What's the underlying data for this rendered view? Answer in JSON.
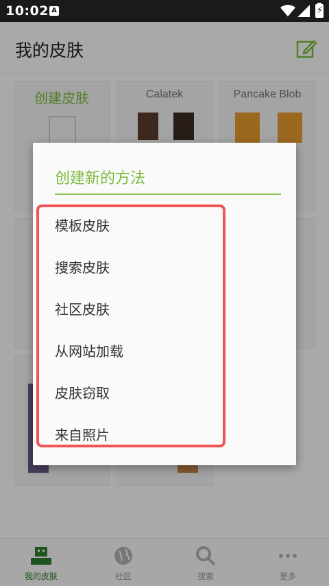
{
  "status_bar": {
    "time": "10:02",
    "notification_icon": "A"
  },
  "app_bar": {
    "title": "我的皮肤",
    "edit_icon": "edit-icon"
  },
  "grid": {
    "cells": [
      {
        "label": "创建皮肤"
      },
      {
        "label": "Calatek"
      },
      {
        "label": "Pancake Blob"
      }
    ]
  },
  "dialog": {
    "title": "创建新的方法",
    "options": [
      {
        "label": "模板皮肤"
      },
      {
        "label": "搜索皮肤"
      },
      {
        "label": "社区皮肤"
      },
      {
        "label": "从网站加载"
      },
      {
        "label": "皮肤窃取"
      },
      {
        "label": "来自照片"
      }
    ]
  },
  "bottom_nav": {
    "items": [
      {
        "label": "我的皮肤",
        "icon": "skin-icon",
        "active": true
      },
      {
        "label": "社区",
        "icon": "globe-icon",
        "active": false
      },
      {
        "label": "搜索",
        "icon": "search-icon",
        "active": false
      },
      {
        "label": "更多",
        "icon": "more-icon",
        "active": false
      }
    ]
  },
  "colors": {
    "accent": "#7cbb3c",
    "highlight": "#f05454",
    "nav_active": "#2e7d32"
  }
}
